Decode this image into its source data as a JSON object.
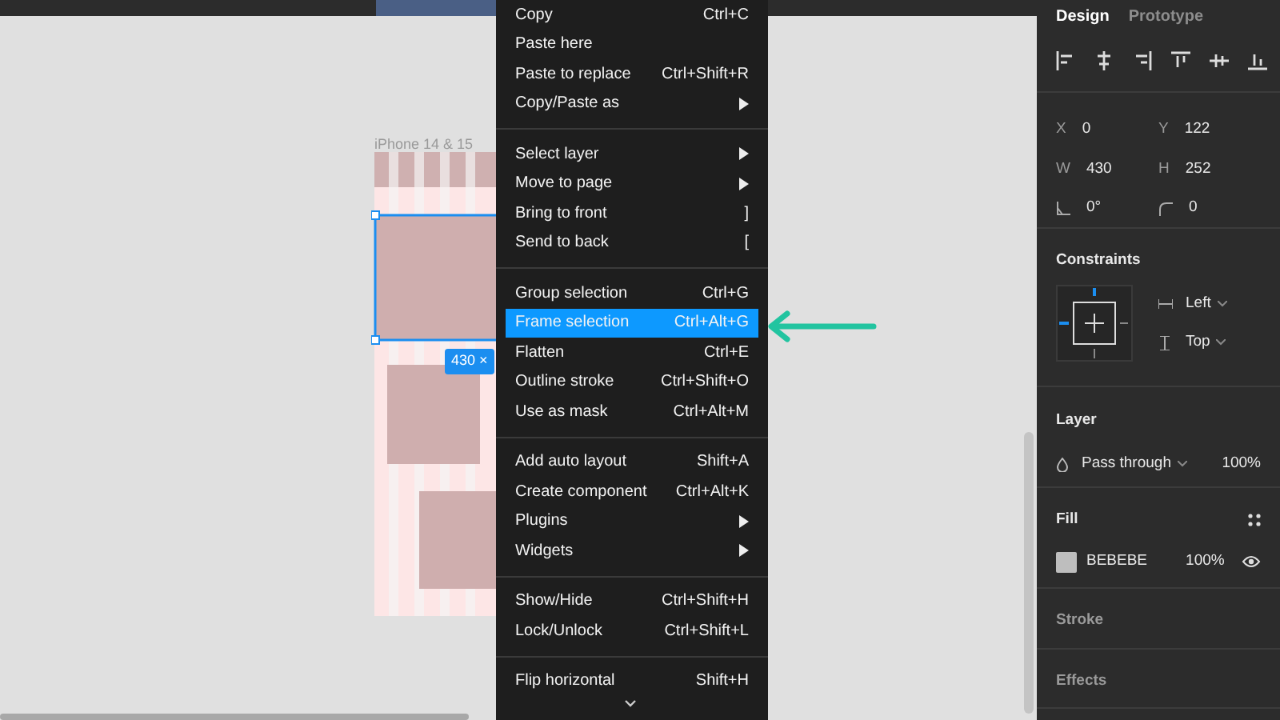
{
  "canvas": {
    "frame_label": "iPhone 14 & 15",
    "selection_size": "430 ×"
  },
  "context_menu": {
    "groups": [
      [
        {
          "label": "Copy",
          "shortcut": "Ctrl+C",
          "submenu": false,
          "selected": false
        },
        {
          "label": "Paste here",
          "submenu": false,
          "selected": false
        },
        {
          "label": "Paste to replace",
          "shortcut": "Ctrl+Shift+R",
          "submenu": false,
          "selected": false
        },
        {
          "label": "Copy/Paste as",
          "submenu": true,
          "selected": false
        }
      ],
      [
        {
          "label": "Select layer",
          "submenu": true,
          "selected": false
        },
        {
          "label": "Move to page",
          "submenu": true,
          "selected": false
        },
        {
          "label": "Bring to front",
          "shortcut": "]",
          "submenu": false,
          "selected": false
        },
        {
          "label": "Send to back",
          "shortcut": "[",
          "submenu": false,
          "selected": false
        }
      ],
      [
        {
          "label": "Group selection",
          "shortcut": "Ctrl+G",
          "submenu": false,
          "selected": false
        },
        {
          "label": "Frame selection",
          "shortcut": "Ctrl+Alt+G",
          "submenu": false,
          "selected": true
        },
        {
          "label": "Flatten",
          "shortcut": "Ctrl+E",
          "submenu": false,
          "selected": false
        },
        {
          "label": "Outline stroke",
          "shortcut": "Ctrl+Shift+O",
          "submenu": false,
          "selected": false
        },
        {
          "label": "Use as mask",
          "shortcut": "Ctrl+Alt+M",
          "submenu": false,
          "selected": false
        }
      ],
      [
        {
          "label": "Add auto layout",
          "shortcut": "Shift+A",
          "submenu": false,
          "selected": false
        },
        {
          "label": "Create component",
          "shortcut": "Ctrl+Alt+K",
          "submenu": false,
          "selected": false
        },
        {
          "label": "Plugins",
          "submenu": true,
          "selected": false
        },
        {
          "label": "Widgets",
          "submenu": true,
          "selected": false
        }
      ],
      [
        {
          "label": "Show/Hide",
          "shortcut": "Ctrl+Shift+H",
          "submenu": false,
          "selected": false
        },
        {
          "label": "Lock/Unlock",
          "shortcut": "Ctrl+Shift+L",
          "submenu": false,
          "selected": false
        }
      ],
      [
        {
          "label": "Flip horizontal",
          "shortcut": "Shift+H",
          "submenu": false,
          "selected": false
        }
      ]
    ]
  },
  "design_panel": {
    "tabs": [
      {
        "label": "Design",
        "selected": true
      },
      {
        "label": "Prototype",
        "selected": false
      }
    ],
    "properties": [
      {
        "kind": "text",
        "label": "X",
        "value": "0"
      },
      {
        "kind": "text",
        "label": "Y",
        "value": "122"
      },
      {
        "kind": "text",
        "label": "W",
        "value": "430"
      },
      {
        "kind": "text",
        "label": "H",
        "value": "252"
      },
      {
        "kind": "angle",
        "value": "0°"
      },
      {
        "kind": "radius",
        "value": "0"
      }
    ],
    "constraints": {
      "title": "Constraints",
      "horizontal": "Left",
      "vertical": "Top"
    },
    "layer": {
      "title": "Layer",
      "blend_mode": "Pass through",
      "opacity": "100%"
    },
    "fill": {
      "title": "Fill",
      "hex": "BEBEBE",
      "opacity": "100%"
    },
    "sections": [
      "Stroke",
      "Effects"
    ]
  }
}
